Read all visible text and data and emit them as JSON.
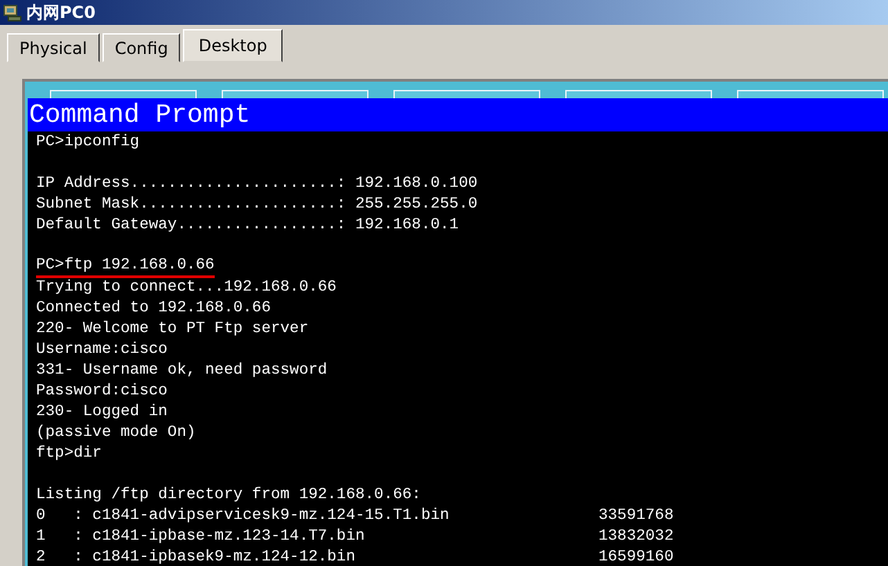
{
  "window": {
    "title": "内网PC0"
  },
  "tabs": [
    {
      "label": "Physical",
      "selected": false
    },
    {
      "label": "Config",
      "selected": false
    },
    {
      "label": "Desktop",
      "selected": true
    }
  ],
  "command_prompt": {
    "title": "Command Prompt",
    "blocks": [
      {
        "lines": [
          {
            "text": "PC>ipconfig",
            "underlined": false
          }
        ]
      },
      {
        "lines": [
          {
            "text": "IP Address......................: 192.168.0.100",
            "underlined": false
          },
          {
            "text": "Subnet Mask.....................: 255.255.255.0",
            "underlined": false
          },
          {
            "text": "Default Gateway.................: 192.168.0.1",
            "underlined": false
          }
        ]
      },
      {
        "lines": [
          {
            "text": "PC>ftp 192.168.0.66",
            "underlined": true
          },
          {
            "text": "Trying to connect...192.168.0.66",
            "underlined": false
          },
          {
            "text": "Connected to 192.168.0.66",
            "underlined": false
          },
          {
            "text": "220- Welcome to PT Ftp server",
            "underlined": false
          },
          {
            "text": "Username:cisco",
            "underlined": false
          },
          {
            "text": "331- Username ok, need password",
            "underlined": false
          },
          {
            "text": "Password:cisco",
            "underlined": false
          },
          {
            "text": "230- Logged in",
            "underlined": false
          },
          {
            "text": "(passive mode On)",
            "underlined": false
          },
          {
            "text": "ftp>dir",
            "underlined": false
          }
        ]
      },
      {
        "lines": [
          {
            "text": "Listing /ftp directory from 192.168.0.66:",
            "underlined": false
          }
        ]
      }
    ],
    "listing": [
      {
        "entry": "0   : c1841-advipservicesk9-mz.124-15.T1.bin",
        "size": "33591768"
      },
      {
        "entry": "1   : c1841-ipbase-mz.123-14.T7.bin",
        "size": "13832032"
      },
      {
        "entry": "2   : c1841-ipbasek9-mz.124-12.bin",
        "size": "16599160"
      }
    ]
  }
}
